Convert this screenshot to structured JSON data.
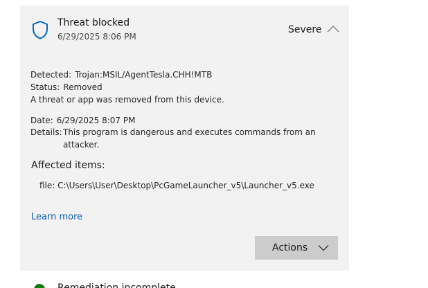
{
  "threat": {
    "title": "Threat blocked",
    "timestamp": "6/29/2025 8:06 PM",
    "severity": "Severe",
    "detected_label": "Detected:",
    "detected_value": "Trojan:MSIL/AgentTesla.CHH!MTB",
    "status_label": "Status:",
    "status_value": "Removed",
    "status_message": "A threat or app was removed from this device.",
    "date_label": "Date:",
    "date_value": "6/29/2025 8:07 PM",
    "details_label": "Details:",
    "details_value": "This program is dangerous and executes commands from an attacker.",
    "affected_title": "Affected items:",
    "affected_items": [
      "file: C:\\Users\\User\\Desktop\\PcGameLauncher_v5\\Launcher_v5.exe"
    ],
    "learn_more": "Learn more",
    "actions_label": "Actions"
  },
  "next_item": {
    "title": "Remediation incomplete"
  },
  "icons": {
    "header": "shield-icon",
    "collapse": "chevron-up-icon",
    "actions": "chevron-down-icon",
    "next": "status-icon"
  },
  "colors": {
    "card_background": "#f2f2f2",
    "shield": "#0067c0",
    "link": "#0a5bb5",
    "actions_button": "#cccccc"
  }
}
